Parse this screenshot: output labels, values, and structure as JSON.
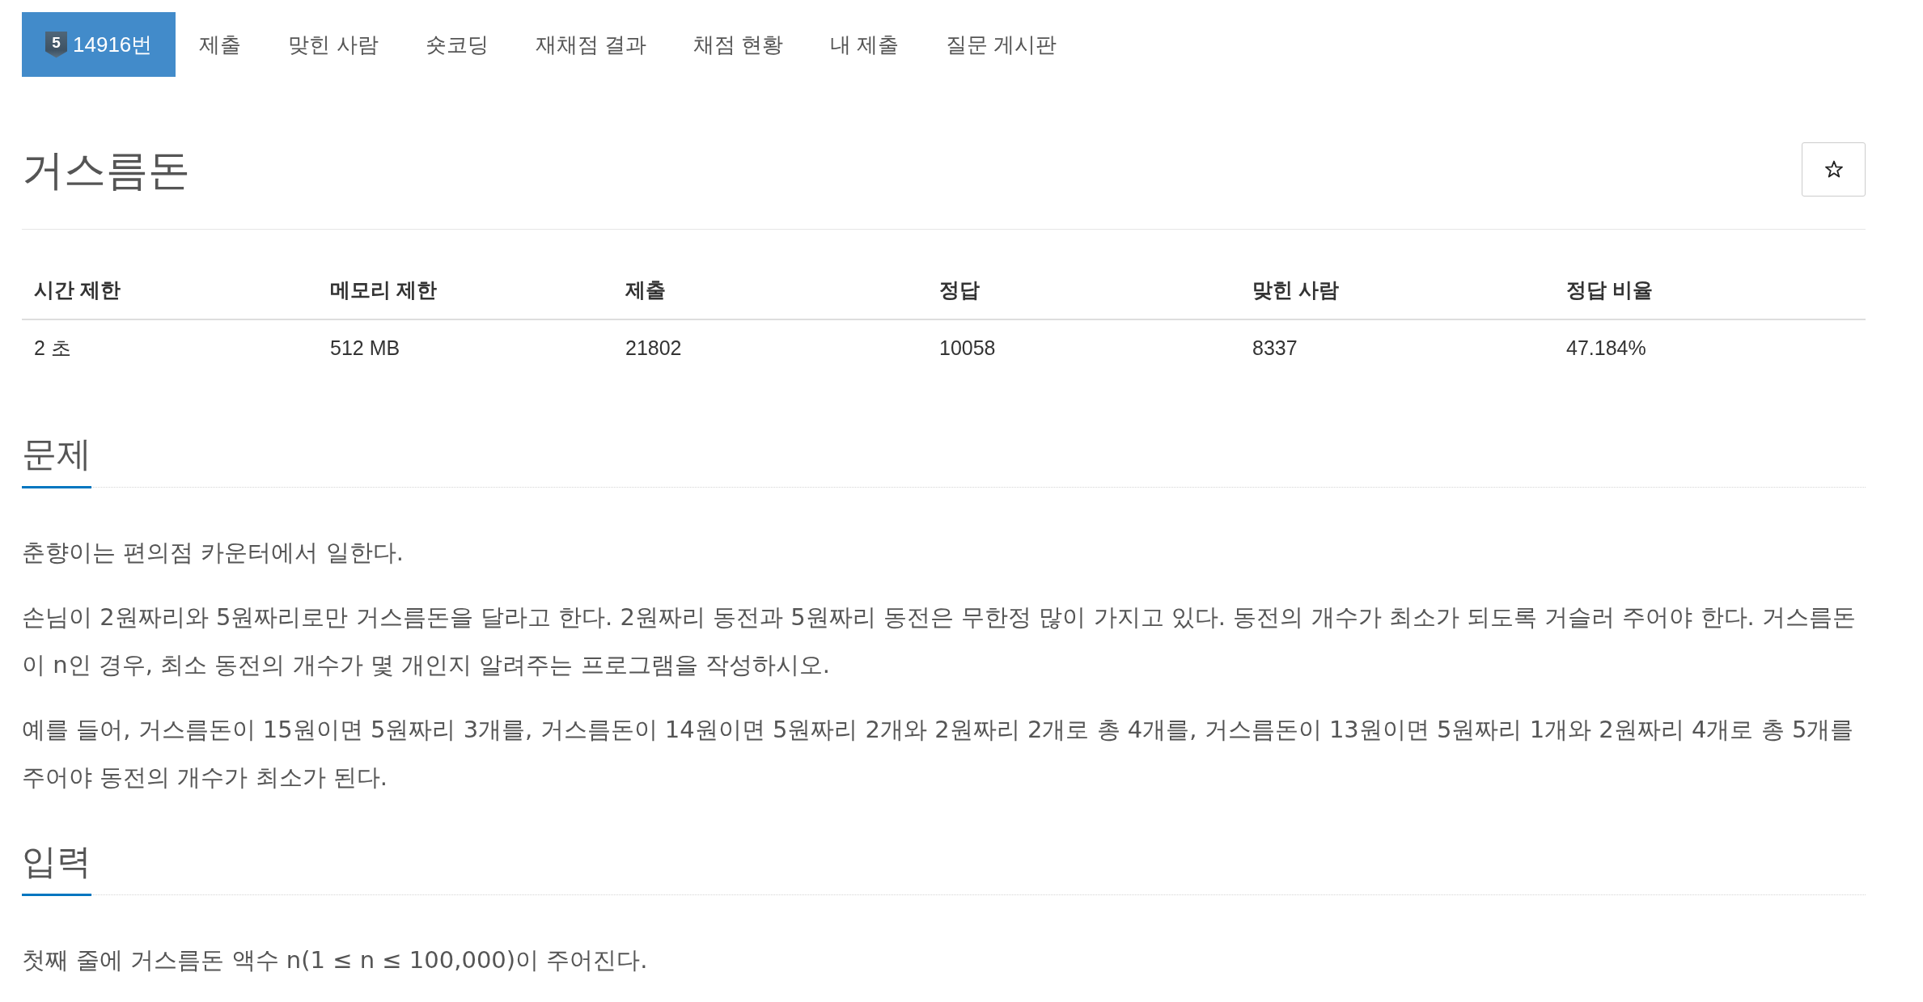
{
  "tabs": [
    {
      "label": "14916번",
      "badge": "5",
      "selected": true
    },
    {
      "label": "제출",
      "selected": false
    },
    {
      "label": "맞힌 사람",
      "selected": false
    },
    {
      "label": "숏코딩",
      "selected": false
    },
    {
      "label": "재채점 결과",
      "selected": false
    },
    {
      "label": "채점 현황",
      "selected": false
    },
    {
      "label": "내 제출",
      "selected": false
    },
    {
      "label": "질문 게시판",
      "selected": false
    }
  ],
  "problem": {
    "title": "거스름돈",
    "starred": false
  },
  "info_table": {
    "columns": [
      "시간 제한",
      "메모리 제한",
      "제출",
      "정답",
      "맞힌 사람",
      "정답 비율"
    ],
    "rows": [
      [
        "2 초",
        "512 MB",
        "21802",
        "10058",
        "8337",
        "47.184%"
      ]
    ]
  },
  "sections": [
    {
      "heading": "문제",
      "paragraphs": [
        "춘향이는 편의점 카운터에서 일한다.",
        "손님이 2원짜리와 5원짜리로만 거스름돈을 달라고 한다. 2원짜리 동전과 5원짜리 동전은 무한정 많이 가지고 있다. 동전의 개수가 최소가 되도록 거슬러 주어야 한다. 거스름돈이 n인 경우, 최소 동전의 개수가 몇 개인지 알려주는 프로그램을 작성하시오.",
        "예를 들어, 거스름돈이 15원이면 5원짜리 3개를, 거스름돈이 14원이면 5원짜리 2개와 2원짜리 2개로 총 4개를, 거스름돈이 13원이면 5원짜리 1개와 2원짜리 4개로 총 5개를 주어야 동전의 개수가 최소가 된다."
      ]
    },
    {
      "heading": "입력",
      "paragraphs": [
        "첫째 줄에 거스름돈 액수 n(1 ≤ n ≤ 100,000)이 주어진다."
      ]
    }
  ]
}
